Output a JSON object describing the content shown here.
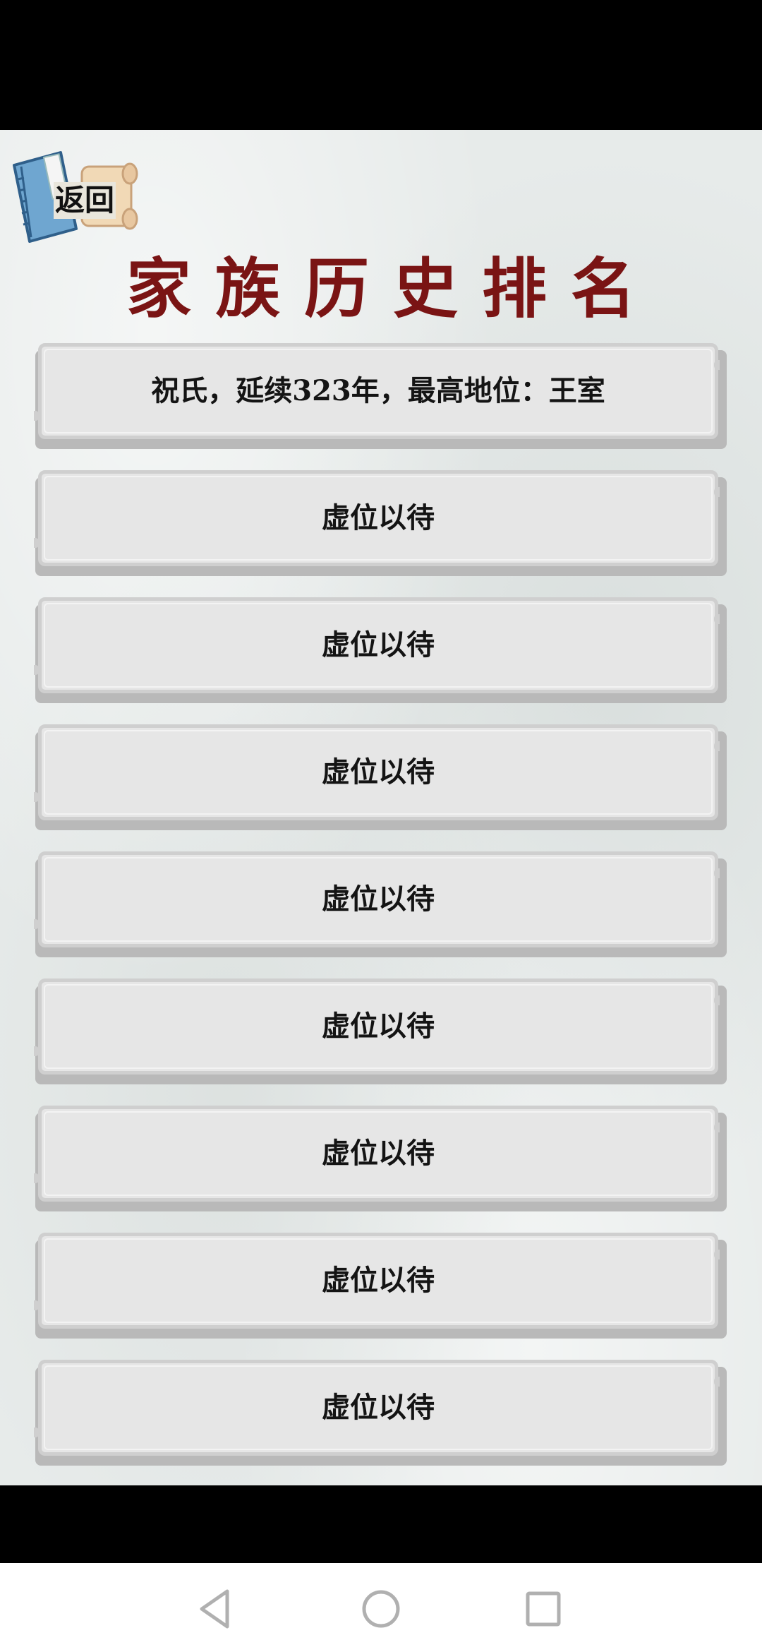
{
  "header": {
    "back_label": "返回",
    "title": "家族历史排名"
  },
  "rankings": [
    {
      "text": "祝氏，延续323年，最高地位：王室"
    },
    {
      "text": "虚位以待"
    },
    {
      "text": "虚位以待"
    },
    {
      "text": "虚位以待"
    },
    {
      "text": "虚位以待"
    },
    {
      "text": "虚位以待"
    },
    {
      "text": "虚位以待"
    },
    {
      "text": "虚位以待"
    },
    {
      "text": "虚位以待"
    }
  ],
  "icons": {
    "back": "book-scroll-icon",
    "nav_back": "triangle-back-icon",
    "nav_home": "circle-home-icon",
    "nav_recent": "square-recent-icon"
  },
  "colors": {
    "title": "#7a1414",
    "row_bg": "#e6e6e6",
    "page_bg": "#e7ebea"
  }
}
